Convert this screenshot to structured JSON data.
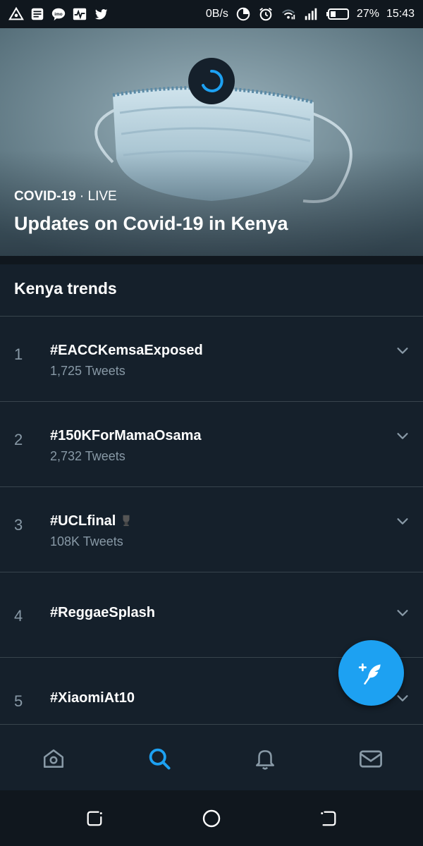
{
  "status_bar": {
    "left_icons": [
      "alert-triangle-icon",
      "news-icon",
      "imo-icon",
      "activity-icon",
      "twitter-icon"
    ],
    "net_speed": "0B/s",
    "battery_percent": "27%",
    "time": "15:43"
  },
  "hero": {
    "category": "COVID-19",
    "separator": " · ",
    "live_label": "LIVE",
    "title": "Updates on Covid-19 in Kenya"
  },
  "trends": {
    "title": "Kenya trends",
    "items": [
      {
        "rank": "1",
        "name": "#EACCKemsaExposed",
        "count": "1,725 Tweets"
      },
      {
        "rank": "2",
        "name": "#150KForMamaOsama",
        "count": "2,732 Tweets"
      },
      {
        "rank": "3",
        "name": "#UCLfinal",
        "count": "108K Tweets"
      },
      {
        "rank": "4",
        "name": "#ReggaeSplash",
        "count": ""
      },
      {
        "rank": "5",
        "name": "#XiaomiAt10",
        "count": ""
      }
    ]
  },
  "colors": {
    "background": "#15202b",
    "accent": "#1da1f2",
    "muted_text": "#8899a6",
    "divider": "#38444d"
  },
  "bottom_nav": [
    "home-icon",
    "search-icon",
    "notifications-icon",
    "messages-icon"
  ],
  "active_tab": "search"
}
